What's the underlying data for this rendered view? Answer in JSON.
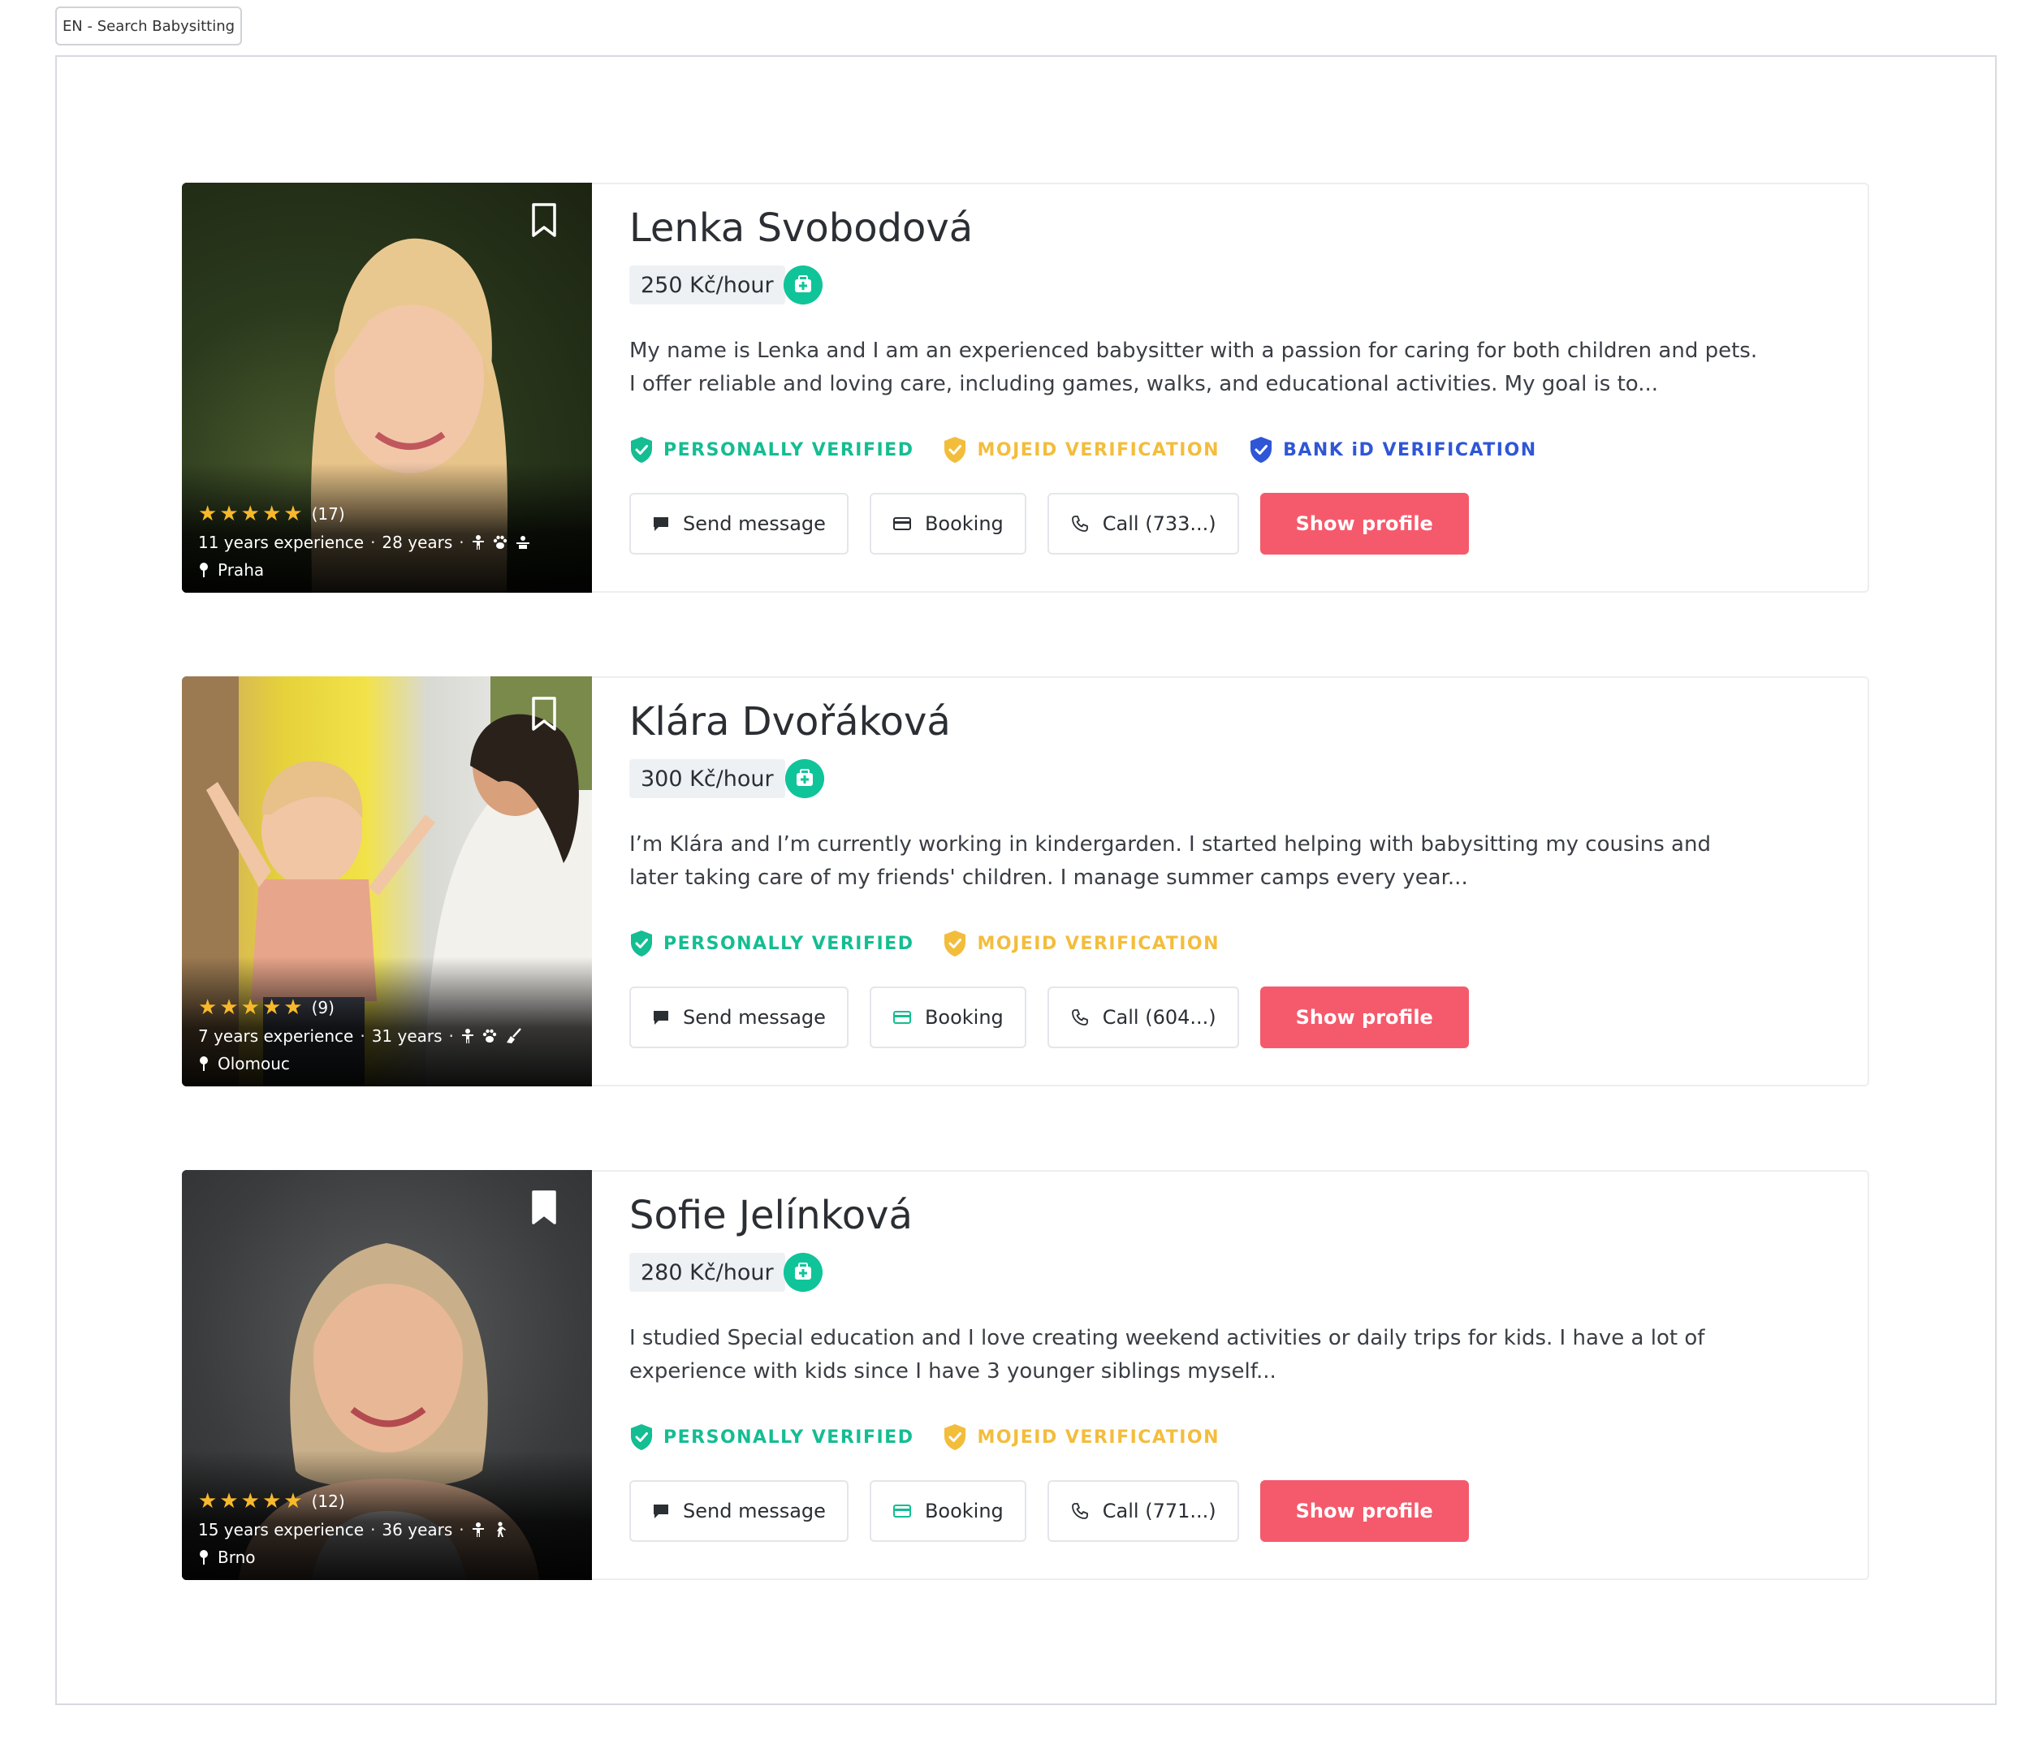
{
  "window": {
    "tab_title": "EN - Search Babysitting"
  },
  "colors": {
    "accent_green": "#14bd92",
    "accent_yellow": "#f3bd3c",
    "accent_blue": "#2f56d6",
    "primary_button": "#f55a6c"
  },
  "buttons": {
    "send_message": "Send message",
    "booking": "Booking",
    "show_profile": "Show profile"
  },
  "badges": {
    "personally_verified": "PERSONALLY VERIFIED",
    "mojeid": "MOJEID VERIFICATION",
    "bankid": "BANK iD VERIFICATION"
  },
  "icons": [
    "bookmark-icon",
    "star-icon",
    "location-pin-icon",
    "child-icon",
    "paw-icon",
    "first-aid-kit-icon",
    "shield-check-icon",
    "message-icon",
    "card-icon",
    "phone-icon"
  ],
  "profiles": [
    {
      "name": "Lenka Svobodová",
      "price": "250 Kč/hour",
      "description": "My name is Lenka and I am an experienced babysitter with a passion for caring for both children and pets. I offer reliable and loving care, including games, walks, and educational activities. My goal is to...",
      "rating": 5,
      "rating_count": "(17)",
      "experience": "11 years experience",
      "age": "28 years",
      "location": "Praha",
      "call": "Call (733...)",
      "bookmarked": false
    },
    {
      "name": "Klára Dvořáková",
      "price": "300 Kč/hour",
      "description": "I’m Klára and I’m currently working in kindergarden. I started  helping with babysitting my cousins and later taking care of my friends' children. I manage summer camps every year...",
      "rating": 5,
      "rating_count": "(9)",
      "experience": "7 years experience",
      "age": "31 years",
      "location": "Olomouc",
      "call": "Call (604...)",
      "bookmarked": false
    },
    {
      "name": "Sofie Jelínková",
      "price": "280 Kč/hour",
      "description": "I studied Special education and I love creating weekend activities or daily trips for kids. I have a lot of experience with kids since I have 3 younger siblings myself...",
      "rating": 5,
      "rating_count": "(12)",
      "experience": "15 years experience",
      "age": "36 years",
      "location": "Brno",
      "call": "Call (771...)",
      "bookmarked": true
    }
  ]
}
